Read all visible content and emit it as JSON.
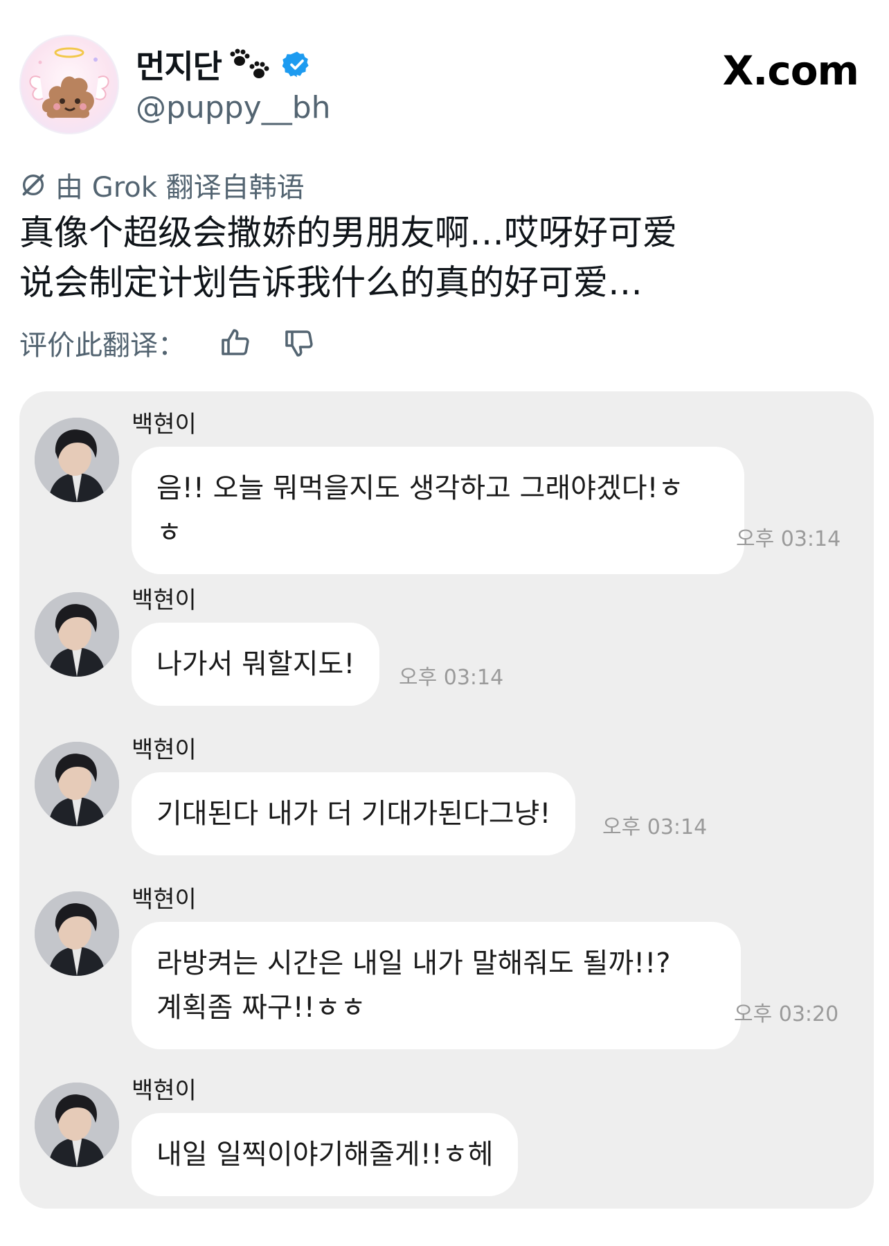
{
  "header": {
    "display_name": "먼지단",
    "handle": "@puppy__bh",
    "site_logo": "X.com",
    "verified_color": "#1d9bf0"
  },
  "translation": {
    "label": "由 Grok 翻译自韩语",
    "text_line1": "真像个超级会撒娇的男朋友啊…哎呀好可爱",
    "text_line2": "说会制定计划告诉我什么的真的好可爱…",
    "rate_label": "评价此翻译："
  },
  "chat": {
    "messages": [
      {
        "sender": "백현이",
        "text": "음!! 오늘 뭐먹을지도 생각하고 그래야겠다!ㅎ\nㅎ",
        "time": "오후 03:14"
      },
      {
        "sender": "백현이",
        "text": "나가서 뭐할지도!",
        "time": "오후 03:14"
      },
      {
        "sender": "백현이",
        "text": "기대된다 내가 더 기대가된다그냥!",
        "time": "오후 03:14"
      },
      {
        "sender": "백현이",
        "text": "라방켜는 시간은 내일 내가 말해줘도 될까!!?\n계획좀 짜구!!ㅎㅎ",
        "time": "오후 03:20"
      },
      {
        "sender": "백현이",
        "text": "내일 일찍이야기해줄게!!ㅎ헤",
        "time": ""
      }
    ]
  }
}
